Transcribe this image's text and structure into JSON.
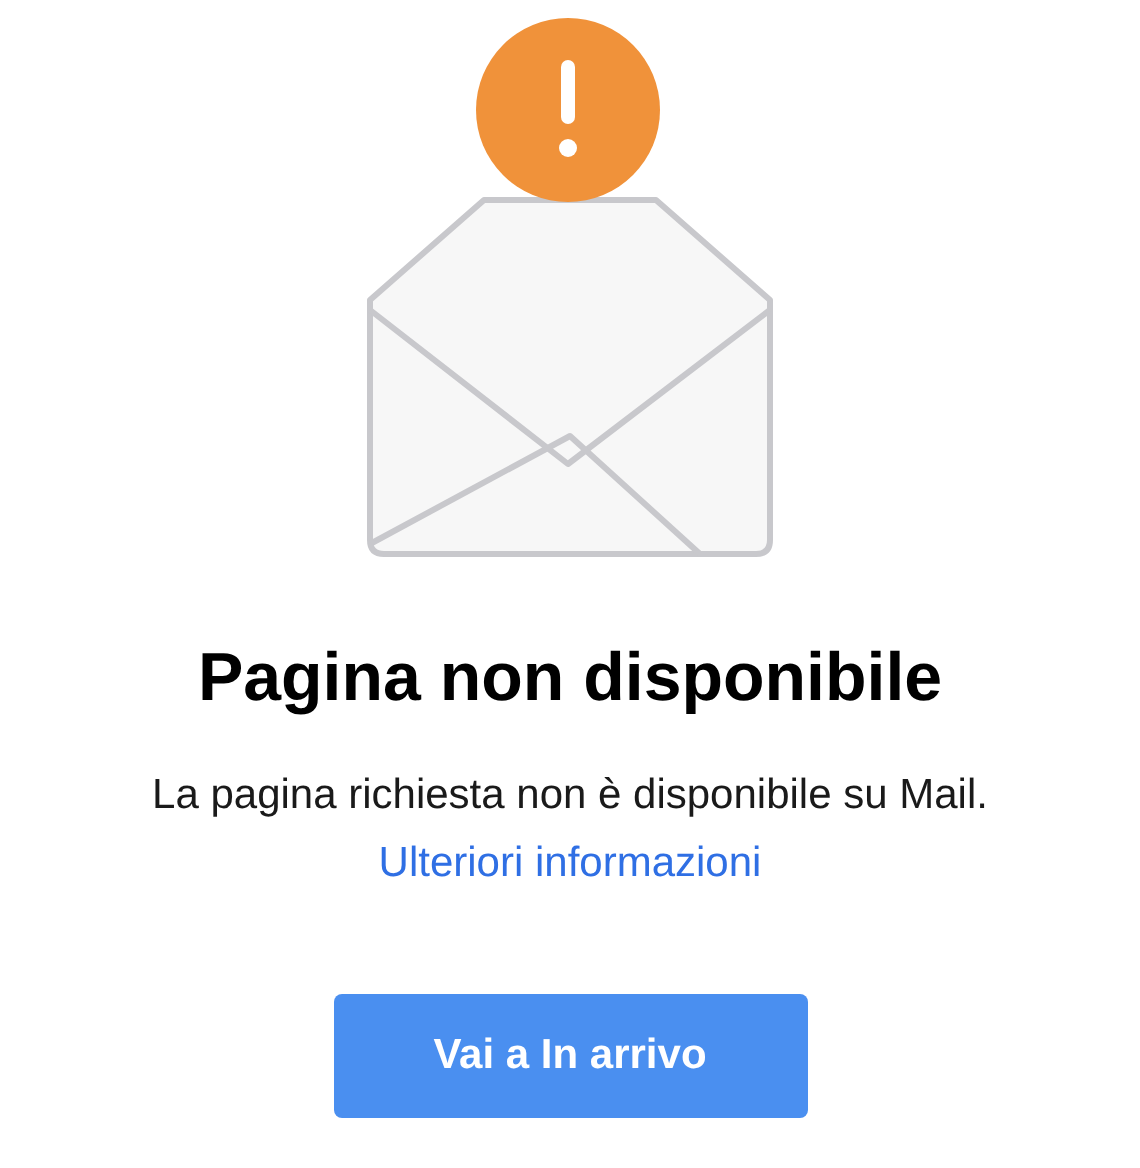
{
  "title": "Pagina non disponibile",
  "message": "La pagina richiesta non è disponibile su Mail.",
  "link": "Ulteriori informazioni",
  "button": "Vai a In arrivo"
}
